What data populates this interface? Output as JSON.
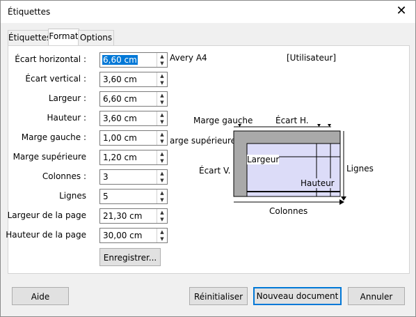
{
  "window": {
    "title": "Étiquettes",
    "close_glyph": "✕"
  },
  "tabs": [
    {
      "label": "Étiquettes",
      "active": false
    },
    {
      "label": "Format",
      "active": true
    },
    {
      "label": "Options",
      "active": false
    }
  ],
  "fields": [
    {
      "label": "Écart horizontal :",
      "value": "6,60 cm"
    },
    {
      "label": "Écart vertical :",
      "value": "3,60 cm"
    },
    {
      "label": "Largeur :",
      "value": "6,60 cm"
    },
    {
      "label": "Hauteur :",
      "value": "3,60 cm"
    },
    {
      "label": "Marge gauche :",
      "value": "1,00 cm"
    },
    {
      "label": "Marge supérieure",
      "value": "1,20 cm"
    },
    {
      "label": "Colonnes :",
      "value": "3"
    },
    {
      "label": "Lignes",
      "value": "5"
    },
    {
      "label": "Largeur de la page",
      "value": "21,30 cm"
    },
    {
      "label": "Hauteur de la page",
      "value": "30,00 cm"
    }
  ],
  "save_button": "Enregistrer...",
  "brand": "Avery A4",
  "type": "[Utilisateur]",
  "diagram": {
    "marge_gauche": "Marge gauche",
    "ecart_h": "Écart H.",
    "marge_sup": "arge supérieure",
    "ecart_v": "Écart V.",
    "largeur": "Largeur",
    "hauteur": "Hauteur",
    "lignes": "Lignes",
    "colonnes": "Colonnes"
  },
  "footer": {
    "help": "Aide",
    "reset": "Réinitialiser",
    "new_doc": "Nouveau document",
    "cancel": "Annuler"
  }
}
